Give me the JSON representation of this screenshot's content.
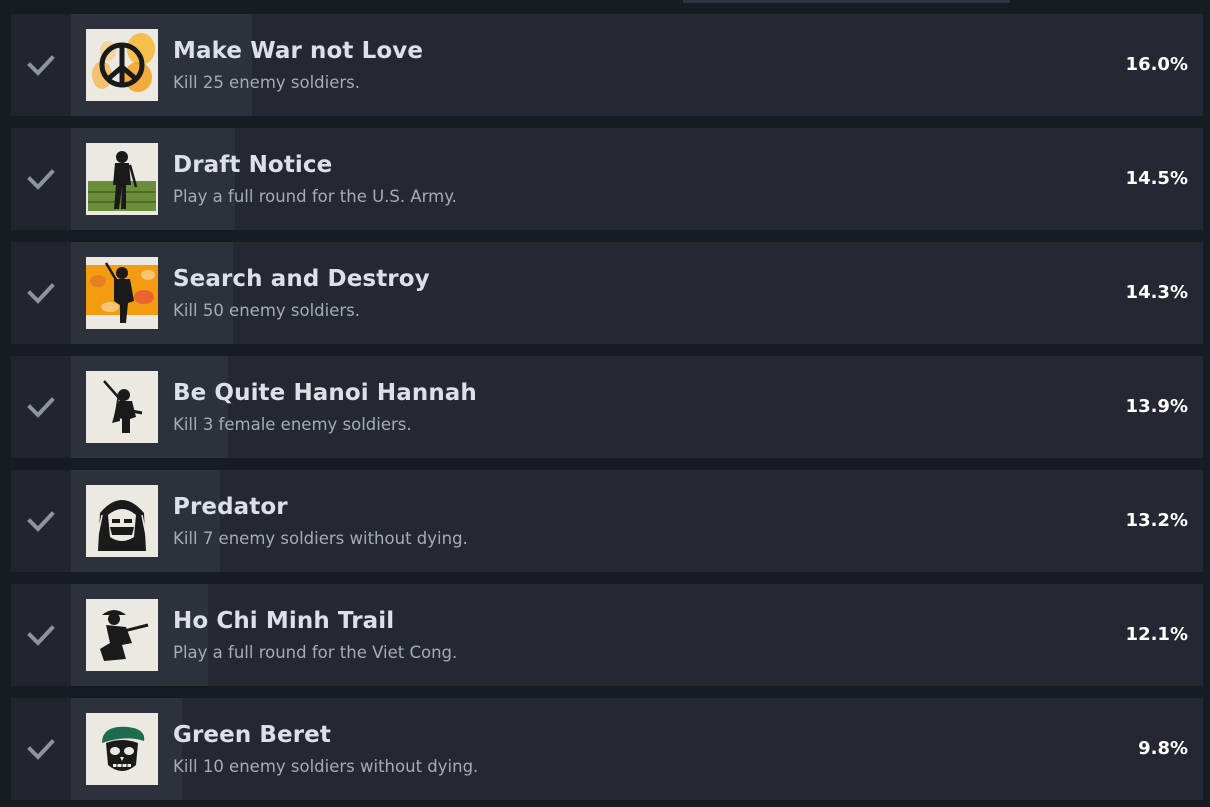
{
  "achievements": [
    {
      "title": "Make War not Love",
      "description": "Kill 25 enemy soldiers.",
      "percent_label": "16.0%",
      "percent": 16.0,
      "icon": "peace-sign-fire-icon"
    },
    {
      "title": "Draft Notice",
      "description": "Play a full round for the U.S. Army.",
      "percent_label": "14.5%",
      "percent": 14.5,
      "icon": "soldier-standing-icon"
    },
    {
      "title": "Search and Destroy",
      "description": "Kill 50 enemy soldiers.",
      "percent_label": "14.3%",
      "percent": 14.3,
      "icon": "soldier-flames-icon"
    },
    {
      "title": "Be Quite Hanoi Hannah",
      "description": "Kill 3 female enemy soldiers.",
      "percent_label": "13.9%",
      "percent": 13.9,
      "icon": "female-soldier-icon"
    },
    {
      "title": "Predator",
      "description": "Kill 7 enemy soldiers without dying.",
      "percent_label": "13.2%",
      "percent": 13.2,
      "icon": "camouflaged-face-icon"
    },
    {
      "title": "Ho Chi Minh Trail",
      "description": "Play a full round for the Viet Cong.",
      "percent_label": "12.1%",
      "percent": 12.1,
      "icon": "crouching-soldier-icon"
    },
    {
      "title": "Green Beret",
      "description": "Kill 10 enemy soldiers without dying.",
      "percent_label": "9.8%",
      "percent": 9.8,
      "icon": "skull-green-beret-icon"
    }
  ],
  "colors": {
    "background": "#171b22",
    "row": "#252832",
    "progress": "#2d313c",
    "title": "#dde0e6",
    "description": "#a6abb6",
    "percent": "#ffffff",
    "check": "#8e939c"
  }
}
